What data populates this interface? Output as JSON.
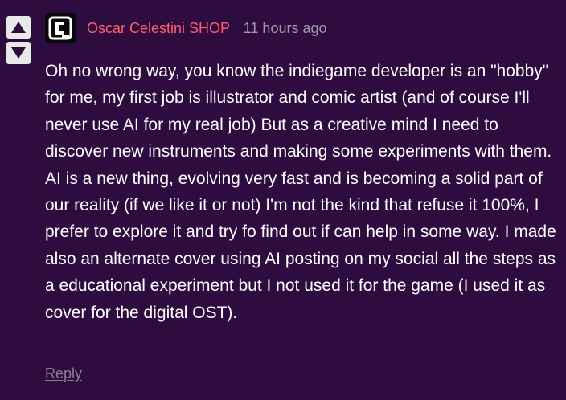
{
  "comment": {
    "author": "Oscar Celestini SHOP",
    "timestamp": "11 hours ago",
    "body": "Oh no wrong way, you know the indiegame developer is an \"hobby\" for me, my first job is illustrator and comic artist (and of course I'll never use AI for my real job) But as a creative mind I need to discover new instruments and making some experiments with them. AI is a new thing, evolving very fast and is becoming a solid part of our reality (if we like it or not) I'm not the kind that refuse it 100%, I prefer to explore it and try fo find out if can help in some way. I made also an alternate cover using AI posting on my social all the steps as a educational experiment but I not used it for the game (I used it as cover for the digital OST).",
    "reply_label": "Reply"
  },
  "icons": {
    "upvote": "arrow-up-icon",
    "downvote": "arrow-down-icon",
    "avatar": "avatar"
  },
  "colors": {
    "background": "#2e0c3f",
    "author": "#ff5f6e",
    "timestamp": "#a59aaa",
    "body": "#ffffff",
    "reply": "#8a7d92",
    "vote_button": "#e8e8e8",
    "vote_arrow": "#2e0c3f"
  }
}
